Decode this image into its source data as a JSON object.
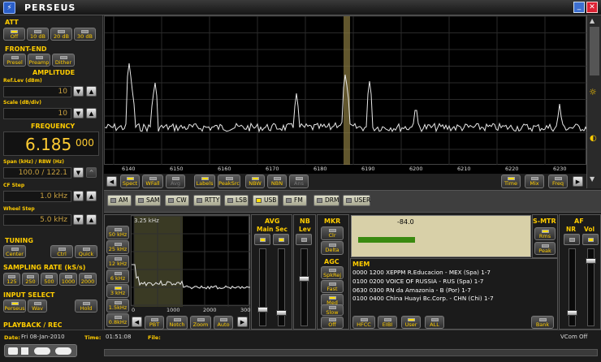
{
  "app": {
    "title": "PERSEUS"
  },
  "att": {
    "label": "ATT",
    "buttons": [
      "Off",
      "10 dB",
      "20 dB",
      "30 dB"
    ]
  },
  "frontend": {
    "label": "FRONT-END",
    "buttons": [
      "Presel",
      "Preamp",
      "Dither"
    ]
  },
  "amplitude": {
    "label": "AMPLITUDE",
    "ref_label": "Ref.Lev (dBm)",
    "ref_value": "10",
    "scale_label": "Scale (dB/div)",
    "scale_value": "10"
  },
  "frequency": {
    "label": "FREQUENCY",
    "main": "6.185",
    "sub": "000",
    "span_label": "Span (kHz) / RBW (Hz)",
    "span_value": "100.0 / 122.1",
    "cf_label": "CF Step",
    "cf_value": "1.0 kHz",
    "wheel_label": "Wheel Step",
    "wheel_value": "5.0 kHz"
  },
  "tuning": {
    "label": "TUNING",
    "buttons": [
      "Center",
      "Ctrl",
      "Quick"
    ]
  },
  "sampling": {
    "label": "SAMPLING RATE (kS/s)",
    "buttons": [
      "125",
      "250",
      "500",
      "1000",
      "2000"
    ]
  },
  "input": {
    "label": "INPUT SELECT",
    "buttons": [
      "Perseus",
      "Wav",
      "Hold"
    ]
  },
  "playback": {
    "label": "PLAYBACK / REC",
    "date_label": "Date:",
    "date": "Fri 08-Jan-2010",
    "time_label": "Time:",
    "time": "01:51:08",
    "file_label": "File:",
    "vcom": "VCom Off"
  },
  "spectrum": {
    "ticks": [
      "6140",
      "6150",
      "6160",
      "6170",
      "6180",
      "6190",
      "6200",
      "6210",
      "6220",
      "6230"
    ],
    "buttons": [
      "Spect",
      "WFall",
      "Avg",
      "Labels",
      "PeakSrc",
      "NBW",
      "NBN",
      "Ans"
    ],
    "right_buttons": [
      "Time",
      "Mix",
      "Freq"
    ]
  },
  "modes": [
    "AM",
    "SAM",
    "CW",
    "RTTY",
    "LSB",
    "USB",
    "FM",
    "DRM",
    "USER"
  ],
  "active_mode": "USB",
  "bw": {
    "label": "BW",
    "options": [
      "50 kHz",
      "25 kHz",
      "12 kHz",
      "6 kHz",
      "3 kHz",
      "1.5kHz",
      "0.8kHz"
    ],
    "filter_value": "3.25 kHz",
    "ticks": [
      "0",
      "1000",
      "2000",
      "300"
    ],
    "buttons": [
      "PBT",
      "Notch",
      "Zoom",
      "Auto"
    ]
  },
  "avg": {
    "label": "AVG",
    "main": "Main",
    "sec": "Sec"
  },
  "nb": {
    "label": "NB",
    "lev": "Lev"
  },
  "mkr": {
    "label": "MKR",
    "buttons": [
      "Clr",
      "Delta"
    ]
  },
  "agc": {
    "label": "AGC",
    "buttons": [
      "SpkRej",
      "Fast",
      "Med",
      "Slow",
      "Off"
    ]
  },
  "smeter": {
    "label": "S-MTR",
    "value": "-84.0",
    "level": 0.35,
    "buttons": [
      "Rms",
      "Peak"
    ]
  },
  "af": {
    "label": "AF",
    "nr": "NR",
    "vol": "Vol"
  },
  "mem": {
    "label": "MEM",
    "entries": [
      "0000 1200 XEPPM R.Educacion  - MEX (Spa)   1-7",
      "0100 0200 VOICE OF RUSSIA  - RUS (Spa)   1-7",
      "0630 0300 RN da Amazonia  - B (Por)   1-7",
      "0100 0400 China Huayi Bc.Corp.  - CHN (Chi)   1-7"
    ],
    "buttons": [
      "HFCC",
      "EIBI",
      "User",
      "ALL",
      "Bank"
    ]
  }
}
